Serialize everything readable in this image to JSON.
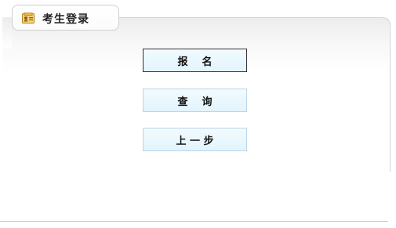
{
  "title": "考生登录",
  "buttons": {
    "register": "报    名",
    "query": "查    询",
    "back": "上 一 步"
  },
  "icons": {
    "title_icon": "id-card-icon"
  },
  "colors": {
    "button_bg": "#e2f4fd",
    "button_border": "#b9d4e6",
    "active_border": "#333333"
  }
}
